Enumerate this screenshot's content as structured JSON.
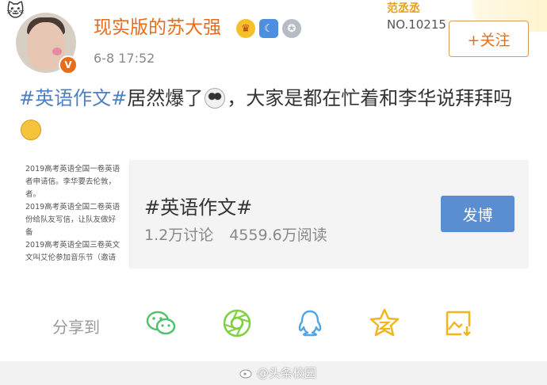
{
  "user": {
    "name": "现实版的苏大强",
    "time": "6-8 17:52",
    "verified_badge": "V",
    "icons": [
      "crown-icon",
      "member-icon",
      "medal-icon"
    ]
  },
  "fan_card": {
    "title": "范丞丞",
    "number": "NO.10215"
  },
  "follow_button": "+关注",
  "post": {
    "hashtag": "#英语作文#",
    "text_1": "居然爆了",
    "text_2": "，大家是都在忙着和李华说拜拜吗"
  },
  "topic": {
    "title": "#英语作文#",
    "discussions": "1.2万讨论",
    "reads": "4559.6万阅读",
    "button": "发博",
    "doc_lines": [
      "2019高考英语全国一卷英语",
      "者申请信。李华要去伦敦，",
      "者。",
      "2019高考英语全国二卷英语",
      "份给队友写信，让队友做好",
      "备",
      "2019高考英语全国三卷英文",
      "文叫艾伦参加音乐节（邀请"
    ]
  },
  "share": {
    "label": "分享到",
    "targets": [
      "wechat-icon",
      "moments-icon",
      "qq-icon",
      "qzone-icon",
      "save-image-icon"
    ]
  },
  "watermark": "@头条校园",
  "colors": {
    "accent_orange": "#e86d1a",
    "link_blue": "#4f7fbf",
    "button_blue": "#5b8ed1",
    "share_green": "#52c26d",
    "share_blue": "#4fa6e6",
    "share_yellow": "#f2b51c"
  }
}
